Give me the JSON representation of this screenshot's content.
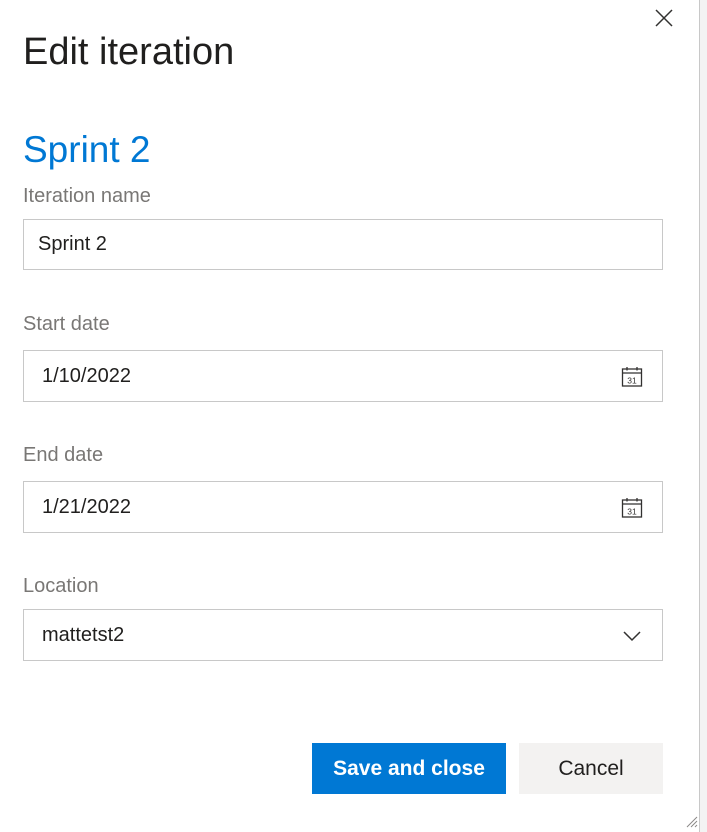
{
  "dialog": {
    "title": "Edit iteration",
    "iteration_heading": "Sprint 2"
  },
  "fields": {
    "iteration_name": {
      "label": "Iteration name",
      "value": "Sprint 2"
    },
    "start_date": {
      "label": "Start date",
      "value": "1/10/2022"
    },
    "end_date": {
      "label": "End date",
      "value": "1/21/2022"
    },
    "location": {
      "label": "Location",
      "value": "mattetst2"
    }
  },
  "calendar_icon_day": "31",
  "buttons": {
    "save_label": "Save and close",
    "cancel_label": "Cancel"
  },
  "icons": {
    "close": "close-icon",
    "calendar": "calendar-icon",
    "chevron": "chevron-down-icon",
    "resize": "resize-grip-icon"
  },
  "colors": {
    "accent": "#0078d4",
    "label": "#797775",
    "text": "#201f1e",
    "border": "#c8c8c8",
    "secondary_button": "#f3f2f1"
  }
}
